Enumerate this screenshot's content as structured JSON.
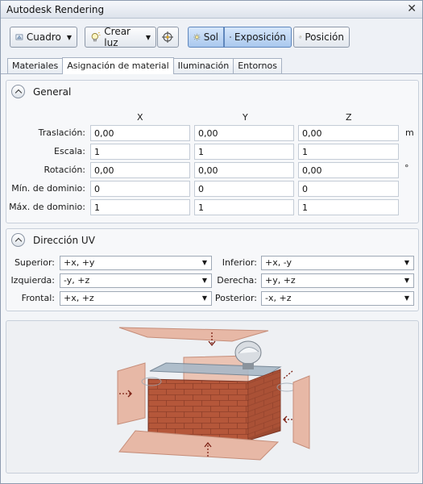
{
  "window": {
    "title": "Autodesk Rendering",
    "close_glyph": "✕"
  },
  "toolbar": {
    "cuadro_label": "Cuadro",
    "crear_luz_label": "Crear luz",
    "sol_label": "Sol",
    "exposicion_label": "Exposición",
    "posicion_label": "Posición"
  },
  "tabs": [
    "Materiales",
    "Asignación de material",
    "Iluminación",
    "Entornos"
  ],
  "active_tab": "Asignación de material",
  "general": {
    "title": "General",
    "columns": [
      "X",
      "Y",
      "Z"
    ],
    "rows": [
      {
        "label": "Traslación:",
        "values": [
          "0,00",
          "0,00",
          "0,00"
        ],
        "unit": "m"
      },
      {
        "label": "Escala:",
        "values": [
          "1",
          "1",
          "1"
        ],
        "unit": ""
      },
      {
        "label": "Rotación:",
        "values": [
          "0,00",
          "0,00",
          "0,00"
        ],
        "unit": "°"
      },
      {
        "label": "Mín. de dominio:",
        "values": [
          "0",
          "0",
          "0"
        ],
        "unit": ""
      },
      {
        "label": "Máx. de dominio:",
        "values": [
          "1",
          "1",
          "1"
        ],
        "unit": ""
      }
    ]
  },
  "uv": {
    "title": "Dirección UV",
    "superior_label": "Superior:",
    "superior_value": "+x, +y",
    "inferior_label": "Inferior:",
    "inferior_value": "+x, -y",
    "izquierda_label": "Izquierda:",
    "izquierda_value": "-y, +z",
    "derecha_label": "Derecha:",
    "derecha_value": "+y, +z",
    "frontal_label": "Frontal:",
    "frontal_value": "+x, +z",
    "posterior_label": "Posterior:",
    "posterior_value": "-x, +z"
  },
  "colors": {
    "accent_active": "#a9c8ee",
    "brick": "#b5573a",
    "plane": "#e7b8a6"
  }
}
